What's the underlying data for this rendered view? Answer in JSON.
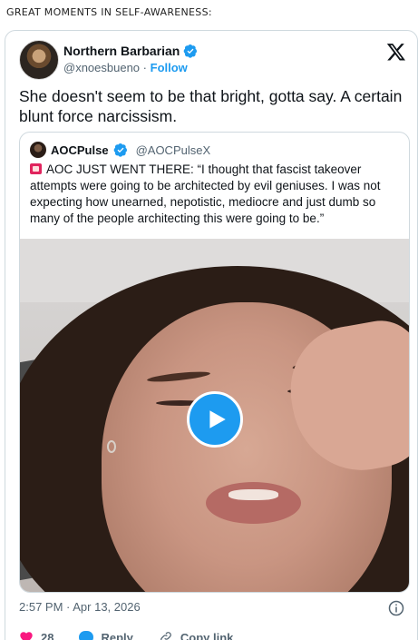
{
  "caption": "GREAT MOMENTS IN SELF-AWARENESS:",
  "tweet": {
    "author_name": "Northern Barbarian",
    "handle": "@xnoesbueno",
    "separator": "·",
    "follow_label": "Follow",
    "text": "She doesn't seem to be that bright, gotta say. A certain blunt force narcissism.",
    "timestamp": "2:57 PM · Apr 13, 2026"
  },
  "quoted": {
    "author_name": "AOCPulse",
    "handle": "@AOCPulseX",
    "text": "AOC JUST WENT THERE: “I thought that fascist takeover attempts were going to be architected by evil geniuses. I was not expecting how unearned, nepotistic, mediocre and just dumb so many of the people architecting this were going to be.”"
  },
  "actions": {
    "like_count": "28",
    "reply_label": "Reply",
    "copy_link_label": "Copy link"
  },
  "colors": {
    "accent": "#1d9bf0",
    "like": "#f91880",
    "text": "#0f1419",
    "muted": "#536471",
    "border": "#cfd9de"
  },
  "icons": [
    "verified-badge-icon",
    "x-logo-icon",
    "siren-icon",
    "play-icon",
    "info-icon",
    "heart-icon",
    "reply-icon",
    "link-icon"
  ]
}
